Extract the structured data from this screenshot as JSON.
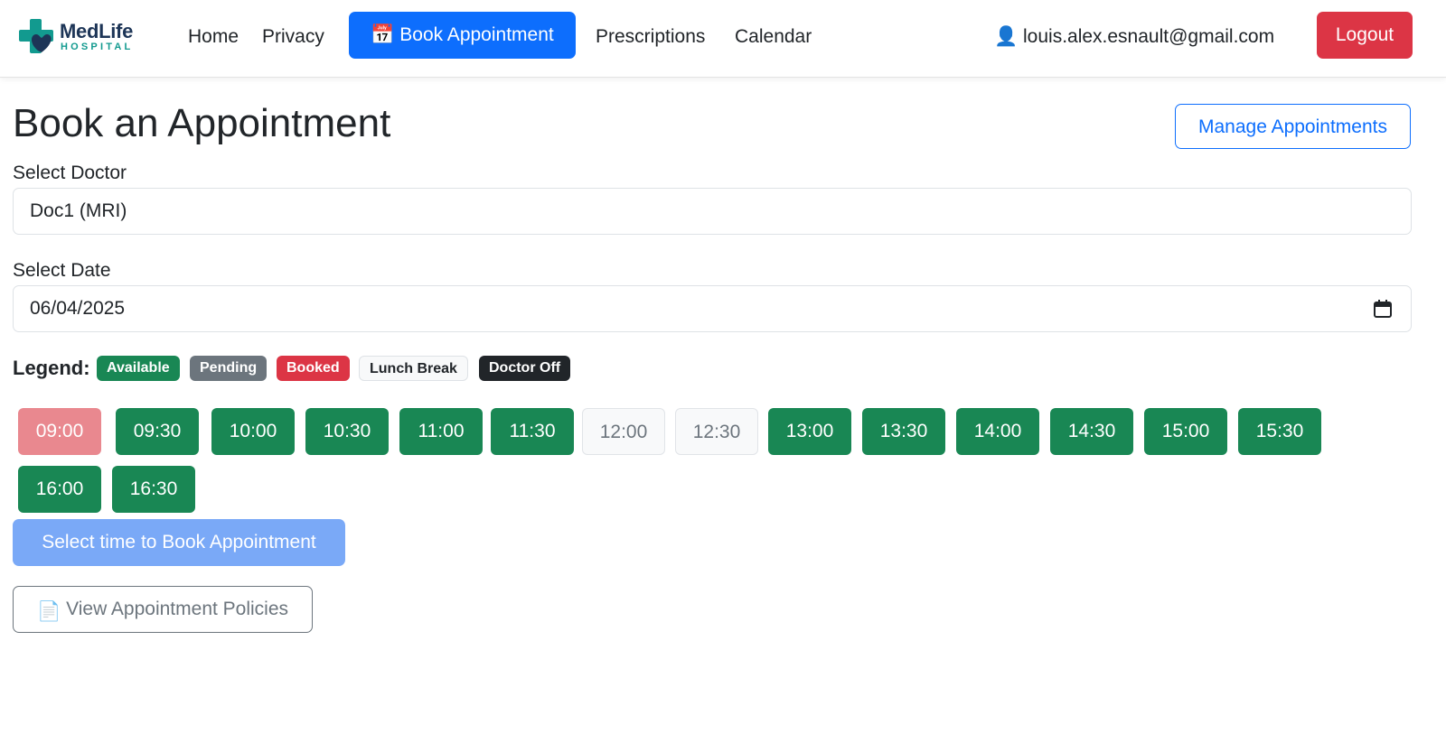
{
  "navbar": {
    "brand_name": "MedLife",
    "brand_sub": "HOSPITAL",
    "links": [
      "Home",
      "Privacy",
      "Book Appointment",
      "Prescriptions",
      "Calendar"
    ],
    "active_icon": "📅",
    "user_icon": "👤",
    "user_email": "louis.alex.esnault@gmail.com",
    "logout_label": "Logout"
  },
  "main": {
    "title": "Book an Appointment",
    "manage_label": "Manage Appointments",
    "doctor_label": "Select Doctor",
    "doctor_value": "Doc1 (MRI)",
    "date_label": "Select Date",
    "date_value": "06/04/2025",
    "legend_title": "Legend:",
    "legend": [
      {
        "label": "Available",
        "bg": "#198754",
        "color": "#ffffff"
      },
      {
        "label": "Pending",
        "bg": "#6c757d",
        "color": "#ffffff"
      },
      {
        "label": "Booked",
        "bg": "#dc3545",
        "color": "#ffffff"
      },
      {
        "label": "Lunch Break",
        "bg": "#f8f9fa",
        "color": "#212529"
      },
      {
        "label": "Doctor Off",
        "bg": "#212529",
        "color": "#ffffff"
      }
    ],
    "slots": [
      {
        "time": "09:00",
        "status": "booked"
      },
      {
        "time": "09:30",
        "status": "available"
      },
      {
        "time": "10:00",
        "status": "available"
      },
      {
        "time": "10:30",
        "status": "available"
      },
      {
        "time": "11:00",
        "status": "available"
      },
      {
        "time": "11:30",
        "status": "available"
      },
      {
        "time": "12:00",
        "status": "lunch"
      },
      {
        "time": "12:30",
        "status": "lunch"
      },
      {
        "time": "13:00",
        "status": "available"
      },
      {
        "time": "13:30",
        "status": "available"
      },
      {
        "time": "14:00",
        "status": "available"
      },
      {
        "time": "14:30",
        "status": "available"
      },
      {
        "time": "15:00",
        "status": "available"
      },
      {
        "time": "15:30",
        "status": "available"
      },
      {
        "time": "16:00",
        "status": "available"
      },
      {
        "time": "16:30",
        "status": "available"
      }
    ],
    "book_label": "Select time to Book Appointment",
    "policies_icon": "📄",
    "policies_label": "View Appointment Policies"
  },
  "colors": {
    "primary": "#0d6efd",
    "danger": "#dc3545",
    "success": "#198754",
    "brand_navy": "#1d3557",
    "brand_teal": "#129a8f"
  }
}
